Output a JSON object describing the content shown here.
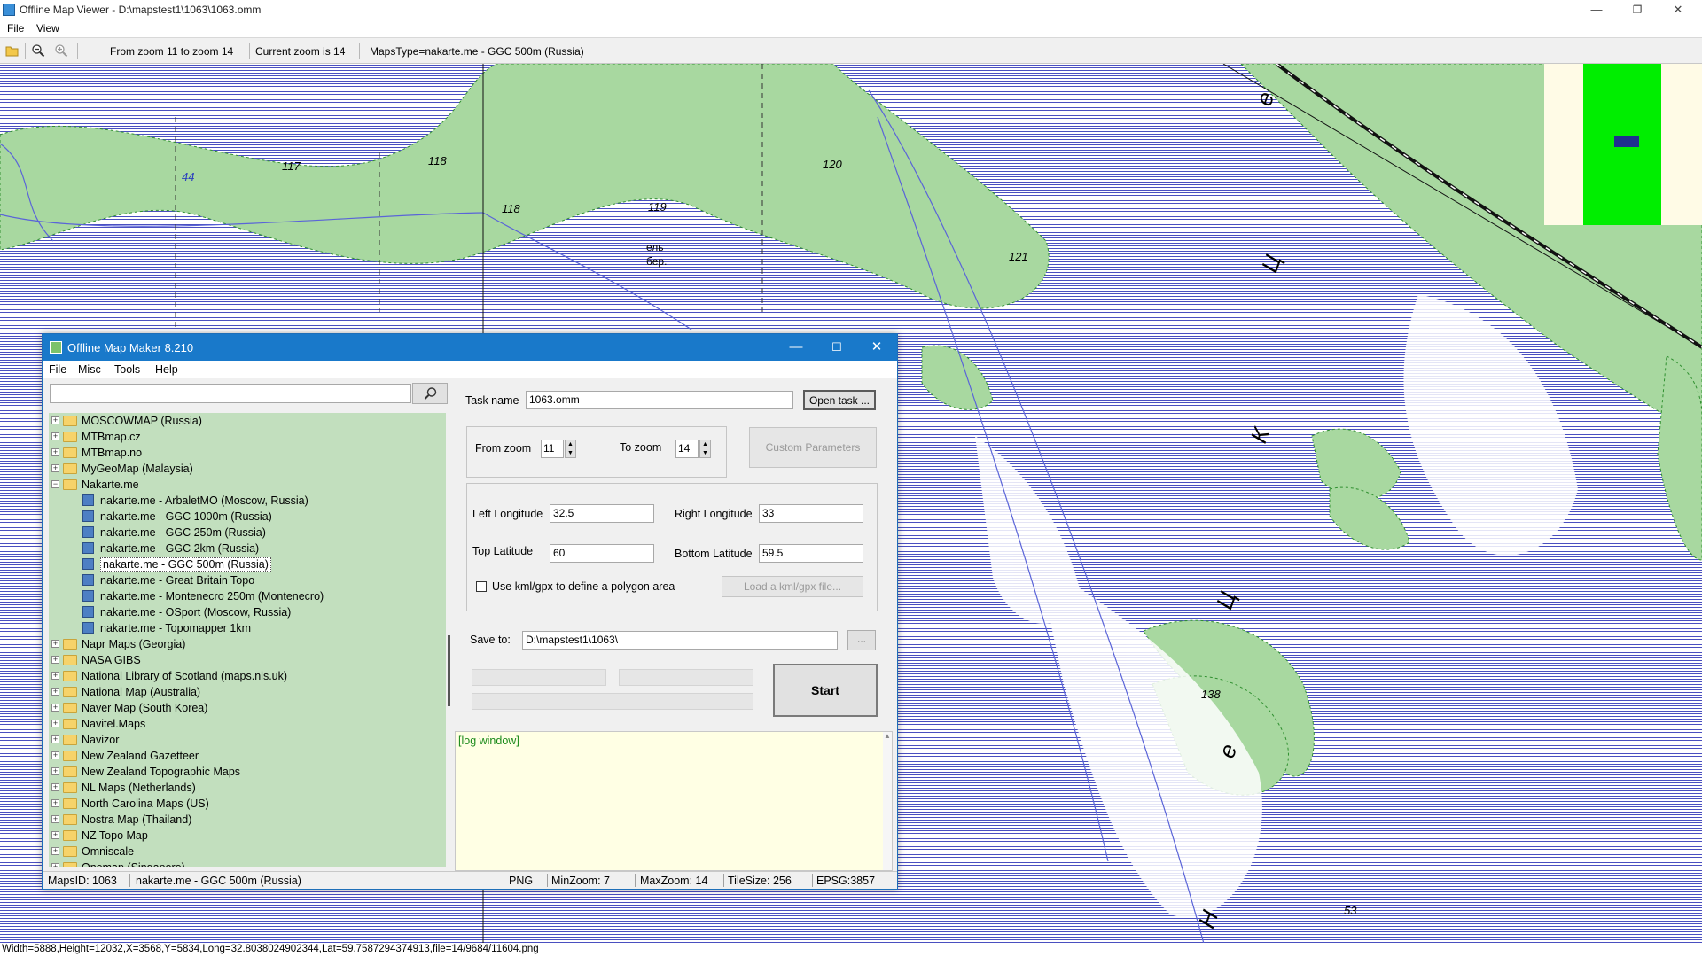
{
  "window": {
    "title": "Offline Map Viewer - D:\\mapstest1\\1063\\1063.omm",
    "minimize": "—",
    "maximize": "❐",
    "close": "✕"
  },
  "menu": [
    "File",
    "View"
  ],
  "toolbar": {
    "zoom_range": "From zoom 11 to zoom 14",
    "current_zoom": "Current zoom is 14",
    "maps_type": "MapsType=nakarte.me - GGC 500m (Russia)"
  },
  "map": {
    "labels": [
      "44",
      "117",
      "118",
      "118",
      "119",
      "120",
      "121",
      "ель",
      "бер.",
      "138",
      "53"
    ],
    "letters": [
      "е",
      "Ц",
      "К",
      "Ц",
      "е",
      "Н"
    ]
  },
  "status_line": "Width=5888,Height=12032,X=3568,Y=5834,Long=32.8038024902344,Lat=59.7587294374913,file=14/9684/11604.png",
  "dialog": {
    "title": "Offline Map Maker 8.210",
    "menu": [
      "File",
      "Misc",
      "Tools",
      "Help"
    ],
    "search_placeholder": "",
    "tree": [
      {
        "label": "MOSCOWMAP (Russia)",
        "level": 0,
        "expanded": false
      },
      {
        "label": "MTBmap.cz",
        "level": 0,
        "expanded": false
      },
      {
        "label": "MTBmap.no",
        "level": 0,
        "expanded": false
      },
      {
        "label": "MyGeoMap (Malaysia)",
        "level": 0,
        "expanded": false
      },
      {
        "label": "Nakarte.me",
        "level": 0,
        "expanded": true
      },
      {
        "label": "nakarte.me - ArbaletMO (Moscow, Russia)",
        "level": 1
      },
      {
        "label": "nakarte.me - GGC 1000m (Russia)",
        "level": 1
      },
      {
        "label": "nakarte.me - GGC 250m (Russia)",
        "level": 1
      },
      {
        "label": "nakarte.me - GGC 2km (Russia)",
        "level": 1
      },
      {
        "label": "nakarte.me - GGC 500m (Russia)",
        "level": 1,
        "selected": true
      },
      {
        "label": "nakarte.me - Great Britain Topo",
        "level": 1
      },
      {
        "label": "nakarte.me - Montenecro 250m (Montenecro)",
        "level": 1
      },
      {
        "label": "nakarte.me - OSport (Moscow, Russia)",
        "level": 1
      },
      {
        "label": "nakarte.me - Topomapper 1km",
        "level": 1
      },
      {
        "label": "Napr Maps (Georgia)",
        "level": 0,
        "expanded": false
      },
      {
        "label": "NASA GIBS",
        "level": 0,
        "expanded": false
      },
      {
        "label": "National Library of Scotland (maps.nls.uk)",
        "level": 0,
        "expanded": false
      },
      {
        "label": "National Map (Australia)",
        "level": 0,
        "expanded": false
      },
      {
        "label": "Naver Map (South Korea)",
        "level": 0,
        "expanded": false
      },
      {
        "label": "Navitel.Maps",
        "level": 0,
        "expanded": false
      },
      {
        "label": "Navizor",
        "level": 0,
        "expanded": false
      },
      {
        "label": "New Zealand Gazetteer",
        "level": 0,
        "expanded": false
      },
      {
        "label": "New Zealand Topographic Maps",
        "level": 0,
        "expanded": false
      },
      {
        "label": "NL Maps (Netherlands)",
        "level": 0,
        "expanded": false
      },
      {
        "label": "North Carolina Maps (US)",
        "level": 0,
        "expanded": false
      },
      {
        "label": "Nostra Map (Thailand)",
        "level": 0,
        "expanded": false
      },
      {
        "label": "NZ Topo Map",
        "level": 0,
        "expanded": false
      },
      {
        "label": "Omniscale",
        "level": 0,
        "expanded": false
      },
      {
        "label": "Onemap (Singapore)",
        "level": 0,
        "expanded": false
      }
    ],
    "task_name_label": "Task name",
    "task_name_value": "1063.omm",
    "open_task_label": "Open task ...",
    "from_zoom_label": "From zoom",
    "from_zoom_value": "11",
    "to_zoom_label": "To zoom",
    "to_zoom_value": "14",
    "custom_params_label": "Custom Parameters",
    "left_lon_label": "Left Longitude",
    "left_lon_value": "32.5",
    "right_lon_label": "Right Longitude",
    "right_lon_value": "33",
    "top_lat_label": "Top Latitude",
    "top_lat_value": "60",
    "bottom_lat_label": "Bottom Latitude",
    "bottom_lat_value": "59.5",
    "kml_check_label": "Use kml/gpx to define a polygon area",
    "kml_checked": false,
    "load_kml_label": "Load a kml/gpx file...",
    "save_to_label": "Save to:",
    "save_to_value": "D:\\mapstest1\\1063\\",
    "browse_label": "...",
    "start_label": "Start",
    "log_text": "[log window]",
    "status": {
      "maps_id": "MapsID: 1063",
      "map_name": "nakarte.me - GGC 500m (Russia)",
      "format": "PNG",
      "min_zoom": "MinZoom: 7",
      "max_zoom": "MaxZoom: 14",
      "tile_size": "TileSize: 256",
      "epsg": "EPSG:3857"
    }
  },
  "colors": {
    "map_hatch": "#4a4fc0",
    "forest": "#a8d8a0",
    "dialog_title": "#1979ca",
    "tree_bg": "#c2dfbe",
    "log_bg": "#ffffe4",
    "log_text": "#1a8a1a",
    "minimap_green": "#00ee00",
    "minimap_marker": "#1f2f8f"
  }
}
